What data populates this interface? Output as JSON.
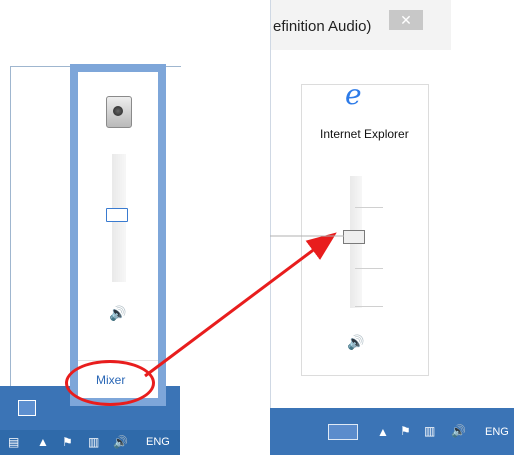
{
  "left_panel": {
    "flyout": {
      "mixer_label": "Mixer"
    },
    "tray": {
      "language": "ENG"
    }
  },
  "right_panel": {
    "title": "efinition Audio)",
    "close_glyph": "✕",
    "app_name": "Internet Explorer",
    "tray": {
      "language": "ENG"
    }
  },
  "icons": [
    "speaker-device-icon",
    "volume-icon",
    "internet-explorer-icon",
    "keyboard-icon",
    "flag-icon",
    "network-icon",
    "chevron-up-icon"
  ],
  "colors": {
    "taskbar": "#3b74b6",
    "accent": "#2a67b6",
    "highlight": "#e81d1d",
    "flyout_border": "#7ea6d9"
  },
  "sliders": {
    "left_volume_level": 0.6,
    "right_volume_level": 0.6
  }
}
